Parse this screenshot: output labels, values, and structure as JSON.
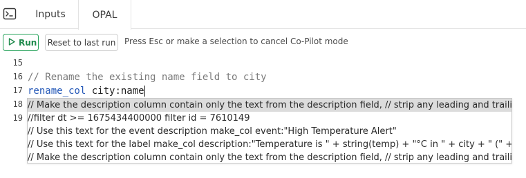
{
  "tabs": {
    "inputs_label": "Inputs",
    "opal_label": "OPAL"
  },
  "toolbar": {
    "run_label": "Run",
    "reset_label": "Reset to last run",
    "hint": "Press Esc or make a selection to cancel Co-Pilot mode"
  },
  "editor": {
    "line_numbers": [
      "15",
      "16",
      "17",
      "18",
      "19"
    ],
    "lines": {
      "l16_comment": "// Rename the existing name field to city",
      "l17_func": "rename_col",
      "l17_args": " city:name"
    }
  },
  "suggestions": [
    " // Make the description column contain only the text from the description field, // strip any leading and trailing",
    "  //filter dt >= 1675434400000 filter id = 7610149",
    "   // Use this text for the event description make_col event:\"High Temperature Alert\"",
    "  // Use this text for the label make_col description:\"Temperature is \" + string(temp) + \"°C in \" + city + \" (\" + coun",
    "  // Make the description column contain only the text from the description field, // strip any leading and trailing"
  ],
  "colors": {
    "run_green": "#1f8a4c",
    "code_function": "#2458b8",
    "comment_gray": "#7a7a7a",
    "selected_suggestion": "#dcdcdc"
  },
  "icons": {
    "terminal": "terminal-icon",
    "play": "play-icon"
  }
}
